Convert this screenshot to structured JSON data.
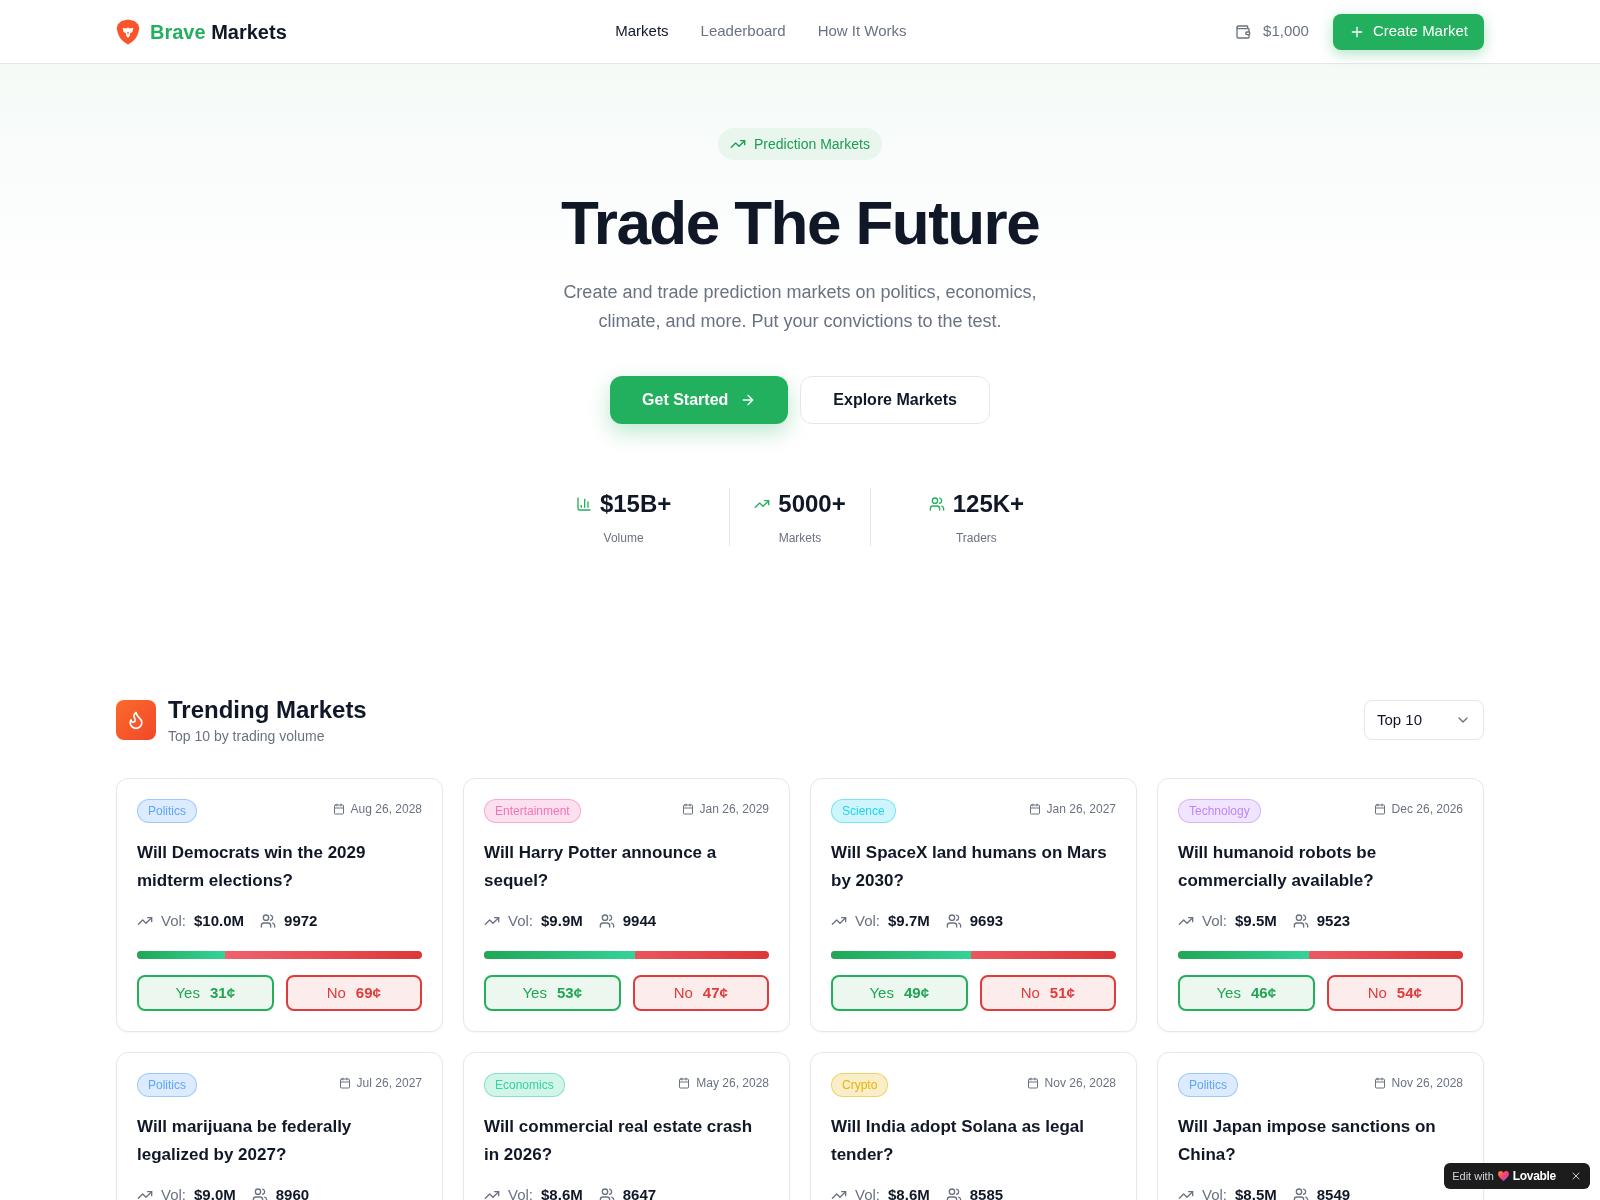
{
  "header": {
    "brand": {
      "accent": "Brave",
      "rest": "Markets"
    },
    "nav": [
      {
        "label": "Markets",
        "selected": true
      },
      {
        "label": "Leaderboard",
        "selected": false
      },
      {
        "label": "How It Works",
        "selected": false
      }
    ],
    "balance": "$1,000",
    "create_button": "Create Market"
  },
  "hero": {
    "badge": "Prediction Markets",
    "title": "Trade The Future",
    "subtitle": "Create and trade prediction markets on politics, economics, climate, and more. Put your convictions to the test.",
    "buttons": [
      {
        "kind": "primary",
        "label": "Get Started"
      },
      {
        "kind": "secondary",
        "label": "Explore Markets"
      }
    ],
    "stats": [
      {
        "value": "$15B+",
        "label": "Volume"
      },
      {
        "value": "5000+",
        "label": "Markets"
      },
      {
        "value": "125K+",
        "label": "Traders"
      }
    ]
  },
  "trending": {
    "title": "Trending Markets",
    "subtitle": "Top 10 by trading volume",
    "filter": "Top 10",
    "markets": [
      {
        "category": "Politics",
        "color": "#60a5fa",
        "date": "Aug 26, 2028",
        "question": "Will Democrats win the 2029 midterm elections?",
        "volume_label": "Vol:",
        "volume": "$10.0M",
        "traders": "9972",
        "level": 0.31,
        "outcomes": [
          {
            "kind": "yes",
            "label": "Yes",
            "price": "31¢"
          },
          {
            "kind": "no",
            "label": "No",
            "price": "69¢"
          }
        ]
      },
      {
        "category": "Entertainment",
        "color": "#f472b6",
        "date": "Jan 26, 2029",
        "question": "Will Harry Potter announce a sequel?",
        "volume_label": "Vol:",
        "volume": "$9.9M",
        "traders": "9944",
        "level": 0.53,
        "outcomes": [
          {
            "kind": "yes",
            "label": "Yes",
            "price": "53¢"
          },
          {
            "kind": "no",
            "label": "No",
            "price": "47¢"
          }
        ]
      },
      {
        "category": "Science",
        "color": "#22d3ee",
        "date": "Jan 26, 2027",
        "question": "Will SpaceX land humans on Mars by 2030?",
        "volume_label": "Vol:",
        "volume": "$9.7M",
        "traders": "9693",
        "level": 0.49,
        "outcomes": [
          {
            "kind": "yes",
            "label": "Yes",
            "price": "49¢"
          },
          {
            "kind": "no",
            "label": "No",
            "price": "51¢"
          }
        ]
      },
      {
        "category": "Technology",
        "color": "#c084fc",
        "date": "Dec 26, 2026",
        "question": "Will humanoid robots be commercially available?",
        "volume_label": "Vol:",
        "volume": "$9.5M",
        "traders": "9523",
        "level": 0.46,
        "outcomes": [
          {
            "kind": "yes",
            "label": "Yes",
            "price": "46¢"
          },
          {
            "kind": "no",
            "label": "No",
            "price": "54¢"
          }
        ]
      },
      {
        "category": "Politics",
        "color": "#60a5fa",
        "date": "Jul 26, 2027",
        "question": "Will marijuana be federally legalized by 2027?",
        "volume_label": "Vol:",
        "volume": "$9.0M",
        "traders": "8960"
      },
      {
        "category": "Economics",
        "color": "#34d399",
        "date": "May 26, 2028",
        "question": "Will commercial real estate crash in 2026?",
        "volume_label": "Vol:",
        "volume": "$8.6M",
        "traders": "8647"
      },
      {
        "category": "Crypto",
        "color": "#eab308",
        "date": "Nov 26, 2028",
        "question": "Will India adopt Solana as legal tender?",
        "volume_label": "Vol:",
        "volume": "$8.6M",
        "traders": "8585"
      },
      {
        "category": "Politics",
        "color": "#60a5fa",
        "date": "Nov 26, 2028",
        "question": "Will Japan impose sanctions on China?",
        "volume_label": "Vol:",
        "volume": "$8.5M",
        "traders": "8549"
      }
    ]
  },
  "edit_badge": {
    "prefix": "Edit with",
    "brand": "Lovable"
  }
}
